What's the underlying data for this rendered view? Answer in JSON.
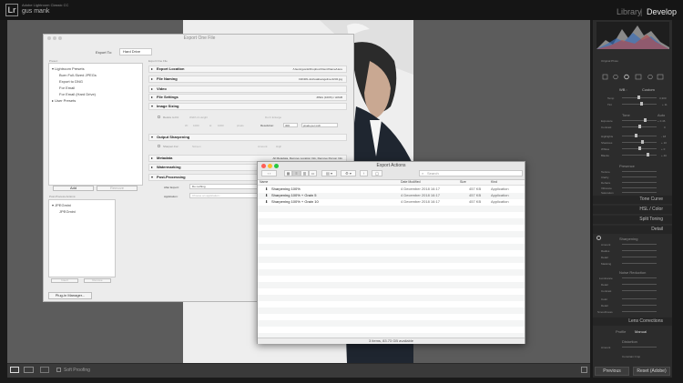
{
  "app": {
    "title": "Adobe Lightroom Classic CC",
    "user": "gus mank",
    "modules": [
      "Library",
      "Develop"
    ],
    "module_separator": "|"
  },
  "toolbar": {
    "soft_proofing": "Soft Proofing"
  },
  "right_panel": {
    "histogram_caption": "Original Photo",
    "basic_labels": {
      "wb": "WB :",
      "custom": "Custom",
      "temp": "Temp",
      "tint": "Tint",
      "temp_val": "3,300",
      "tint_val": "+ 11",
      "tone": "Tone",
      "auto": "Auto",
      "exposure": "Exposure",
      "exposure_val": "+ 0.46",
      "contrast": "Contrast",
      "contrast_val": "0",
      "highlights": "Highlights",
      "highlights_val": "- 18",
      "shadows": "Shadows",
      "shadows_val": "+ 10",
      "whites": "Whites",
      "whites_val": "+ 0",
      "blacks": "Blacks",
      "blacks_val": "+ 40",
      "presence": "Presence",
      "texture": "Texture",
      "clarity": "Clarity",
      "dehaze": "Dehaze",
      "vibrance": "Vibrance",
      "saturation": "Saturation"
    },
    "sections": [
      "Tone Curve",
      "HSL / Color",
      "Split Toning",
      "Detail",
      "Lens Corrections"
    ],
    "detail": {
      "sharpening": "Sharpening",
      "amount": "Amount",
      "radius": "Radius",
      "detail": "Detail",
      "masking": "Masking",
      "noise_reduction": "Noise Reduction",
      "luminance": "Luminance",
      "l_detail": "Detail",
      "l_contrast": "Contrast",
      "color": "Color",
      "c_detail": "Detail",
      "smoothness": "Smoothness"
    },
    "lens": {
      "profile": "Profile",
      "manual": "Manual",
      "distortion": "Distortion",
      "amount": "Amount",
      "constrain": "Constrain Crop"
    },
    "buttons": {
      "previous": "Previous",
      "reset": "Reset (Adobe)"
    }
  },
  "export_dialog": {
    "title": "Export One File",
    "export_to_label": "Export To:",
    "export_to_value": "Hard Drive",
    "preset_header": "Preset:",
    "export_one_file": "Export One File",
    "presets": [
      "Lightroom Presets",
      "Burn Full-Sized JPEGs",
      "Export to DNG",
      "For Email",
      "For Email (Hard Drive)",
      "User Presets"
    ],
    "add_button": "Add",
    "remove_button": "Remove",
    "post_process_header": "Post-Process Actions:",
    "post_process_items": [
      "JPEGmini",
      "JPEGmini"
    ],
    "insert_button": "Insert",
    "pp_remove_button": "Remove",
    "plugin_manager": "Plug-in Manager...",
    "sections": [
      {
        "label": "Export Location",
        "value": "/Users/gusnk/Dropbox/Client/Name/Here"
      },
      {
        "label": "File Naming",
        "value": "190409-JoshuaEvangeline-0232.jpg"
      },
      {
        "label": "Video",
        "value": ""
      },
      {
        "label": "File Settings",
        "value": "JPEG (100%) / sRGB"
      },
      {
        "label": "Image Sizing",
        "value": ""
      },
      {
        "label": "Output Sharpening",
        "value": ""
      },
      {
        "label": "Metadata",
        "value": "All Metadata, Remove Location Info, Remove Person Info"
      },
      {
        "label": "Watermarking",
        "value": ""
      },
      {
        "label": "Post-Processing",
        "value": ""
      }
    ],
    "image_sizing": {
      "resize": "Resize to Fit:",
      "wh": "Width & Height",
      "dont_enlarge": "Don't Enlarge",
      "w": "W:",
      "h": "H:",
      "w_val": "1000",
      "h_val": "1000",
      "units": "pixels",
      "resolution": "Resolution:",
      "res_val": "300",
      "res_units": "pixels per inch"
    },
    "output_sharpening": {
      "sharpen_for": "Sharpen For:",
      "screen": "Screen",
      "amount": "Amount:",
      "high": "High"
    },
    "post_processing": {
      "after_export": "After Export:",
      "after_value": "Do nothing",
      "application": "Application:",
      "app_placeholder": "Choose an application..."
    }
  },
  "finder": {
    "title": "Export Actions",
    "search_placeholder": "Search",
    "columns": [
      "Name",
      "Date Modified",
      "Size",
      "Kind"
    ],
    "rows": [
      {
        "name": "Sharpening 100%",
        "date": "4 December 2018 16:17",
        "size": "457 KB",
        "kind": "Application"
      },
      {
        "name": "Sharpening 100% + Grain 5",
        "date": "4 December 2018 16:17",
        "size": "457 KB",
        "kind": "Application"
      },
      {
        "name": "Sharpening 100% + Grain 10",
        "date": "4 December 2018 16:17",
        "size": "457 KB",
        "kind": "Application"
      }
    ],
    "status": "3 items, 83.73 GB available"
  },
  "colors": {
    "accent_red": "#ff5f57",
    "accent_yellow": "#febc2e",
    "accent_green": "#28c840",
    "panel": "#2c2c2c",
    "workspace": "#5c5c5c"
  }
}
